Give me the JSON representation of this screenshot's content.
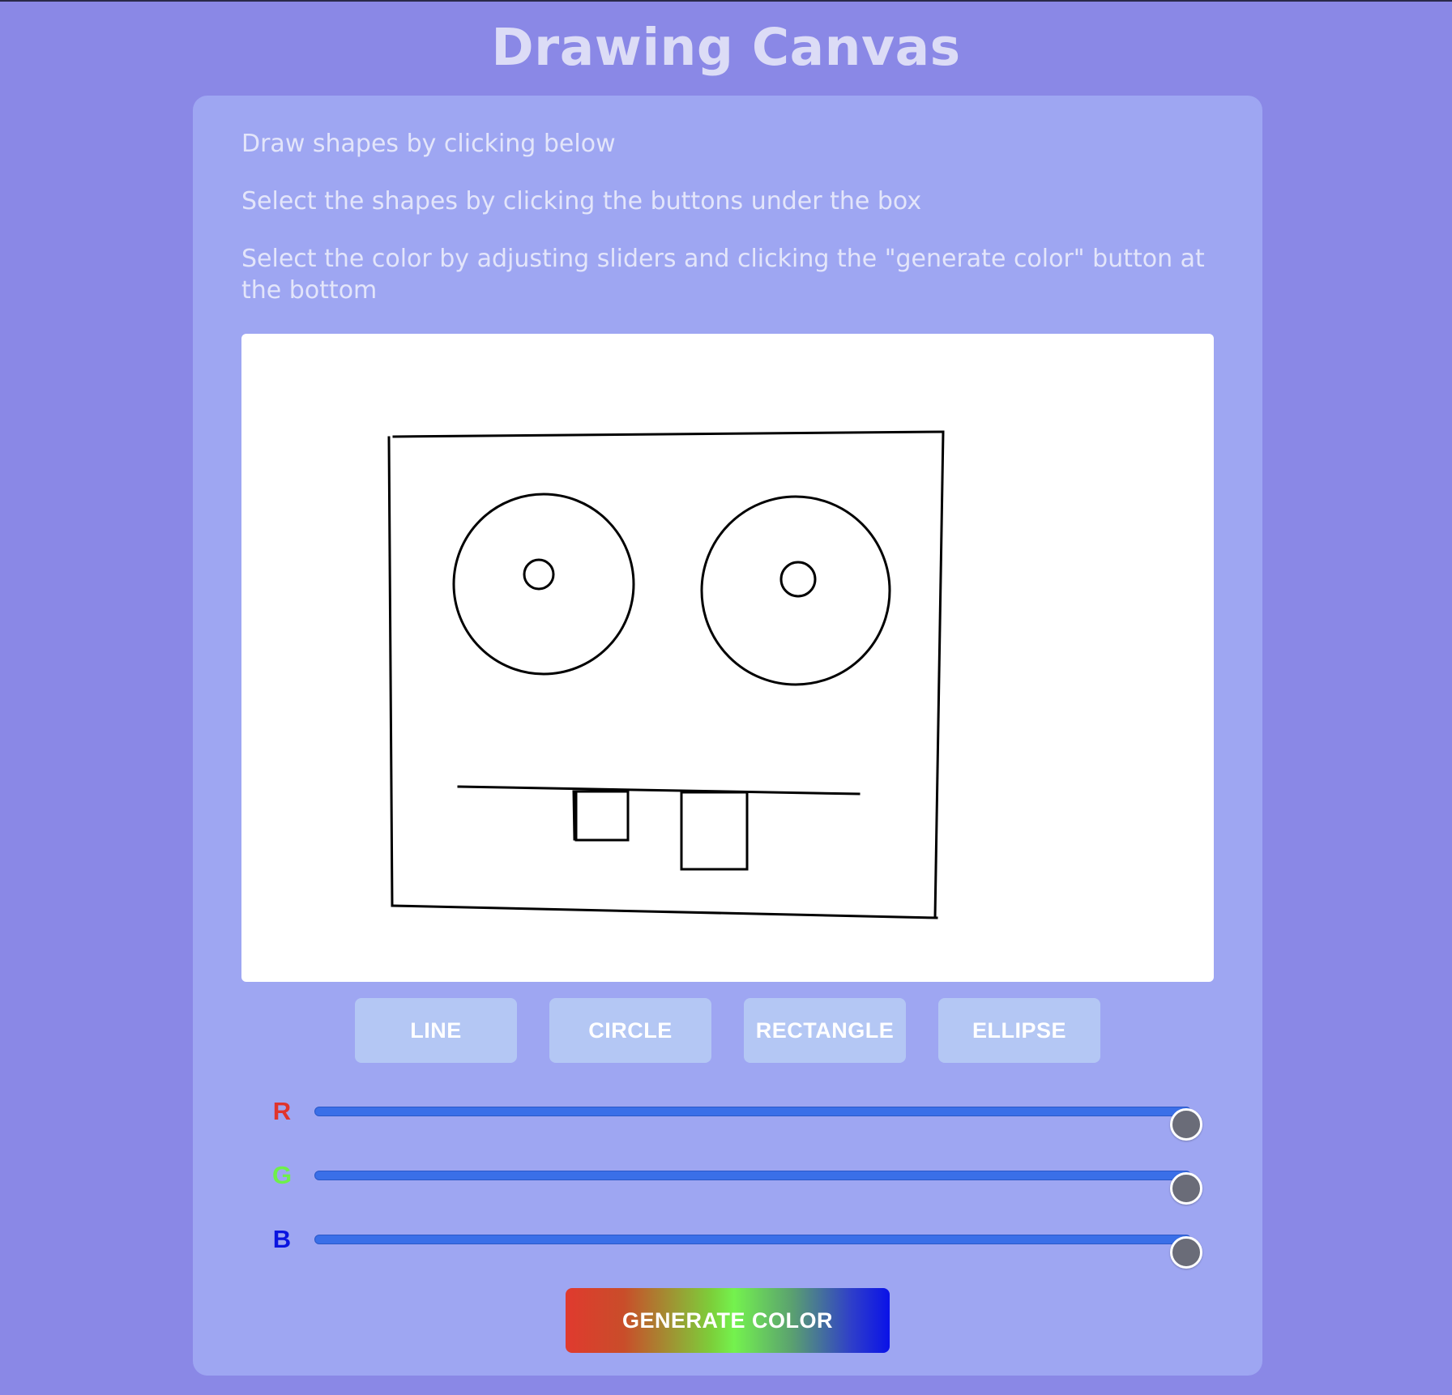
{
  "page": {
    "title": "Drawing Canvas"
  },
  "instructions": [
    "Draw shapes by clicking below",
    "Select the shapes by clicking the buttons under the box",
    "Select the color by adjusting sliders and clicking the \"generate color\" button at the bottom"
  ],
  "shape_buttons": [
    {
      "label": "LINE"
    },
    {
      "label": "CIRCLE"
    },
    {
      "label": "RECTANGLE"
    },
    {
      "label": "ELLIPSE"
    }
  ],
  "sliders": [
    {
      "label": "R",
      "value": 255,
      "max": 255,
      "color": "#e0342c"
    },
    {
      "label": "G",
      "value": 255,
      "max": 255,
      "color": "#6ef04a"
    },
    {
      "label": "B",
      "value": 255,
      "max": 255,
      "color": "#0a14e0"
    }
  ],
  "generate_button": {
    "label": "GENERATE COLOR"
  },
  "colors": {
    "background": "#8a88e6",
    "panel": "#9ea6f2",
    "button": "#b4c7f4",
    "slider_track": "#3a6fe8"
  }
}
